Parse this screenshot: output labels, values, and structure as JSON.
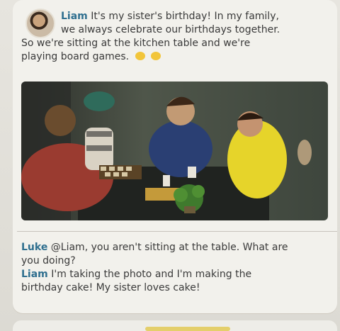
{
  "post": {
    "author": "Liam",
    "lines": [
      "It's my sister's birthday! In my family,",
      "we always celebrate our birthdays together.",
      "So we're sitting at the kitchen table and we're",
      "playing board games."
    ],
    "emoji_icons": [
      "smiling-emoji-icon",
      "smiling-emoji-icon"
    ]
  },
  "comments": [
    {
      "author": "Luke",
      "lines": [
        "@Liam, you aren't sitting at the table. What are",
        "you doing?"
      ]
    },
    {
      "author": "Liam",
      "lines": [
        "I'm taking the photo and I'm making the",
        "birthday cake! My sister loves cake!"
      ]
    }
  ],
  "colors": {
    "username": "#2f6f8f",
    "text": "#3a3a3a",
    "card": "#f2f1ec"
  }
}
